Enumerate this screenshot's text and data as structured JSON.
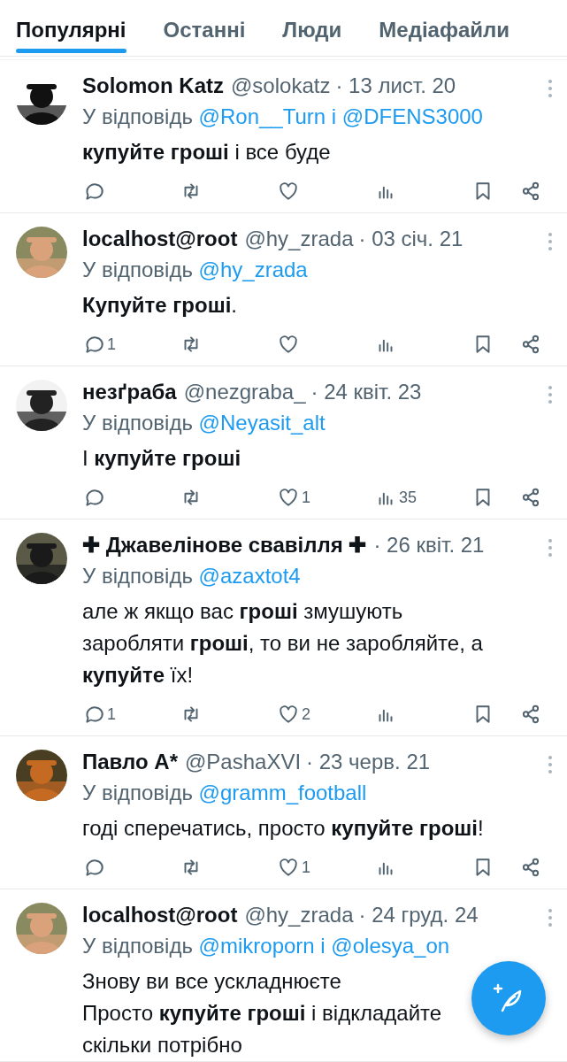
{
  "tabs": [
    {
      "label": "Популярні",
      "selected": true
    },
    {
      "label": "Останні",
      "selected": false
    },
    {
      "label": "Люди",
      "selected": false
    },
    {
      "label": "Медіафайли",
      "selected": false
    }
  ],
  "tweets": [
    {
      "name": "Solomon Katz",
      "handle": "@solokatz",
      "date": "· 13 лист. 20",
      "reply": {
        "label": "У відповідь",
        "mentions": [
          "@Ron__Turn",
          "@DFENS3000"
        ],
        "joiner": "і"
      },
      "text": "**купуйте гроші** і все буде",
      "actions": [
        {
          "kind": "reply"
        },
        {
          "kind": "retweet"
        },
        {
          "kind": "like"
        },
        {
          "kind": "views"
        }
      ]
    },
    {
      "name": "localhost@root",
      "handle": "@hy_zrada",
      "date": "· 03 січ. 21",
      "reply": {
        "label": "У відповідь",
        "mentions": [
          "@hy_zrada"
        ]
      },
      "text": "**Купуйте гроші**.",
      "actions": [
        {
          "kind": "reply",
          "count": "1"
        },
        {
          "kind": "retweet"
        },
        {
          "kind": "like"
        },
        {
          "kind": "views"
        }
      ]
    },
    {
      "name": "незґраба",
      "handle": "@nezgraba_",
      "date": "· 24 квіт. 23",
      "reply": {
        "label": "У відповідь",
        "mentions": [
          "@Neyasit_alt"
        ]
      },
      "text": "І **купуйте гроші**",
      "actions": [
        {
          "kind": "reply"
        },
        {
          "kind": "retweet"
        },
        {
          "kind": "like",
          "count": "1"
        },
        {
          "kind": "views",
          "count": "35"
        }
      ]
    },
    {
      "name": "✚ Джавелінове свавілля ✚",
      "date": "· 26 квіт. 21",
      "reply": {
        "label": "У відповідь",
        "mentions": [
          "@azaxtot4"
        ]
      },
      "text": "але ж якщо вас **гроші** змушують заробляти **гроші**, то ви не заробляйте, а **купуйте** їх!",
      "actions": [
        {
          "kind": "reply",
          "count": "1"
        },
        {
          "kind": "retweet"
        },
        {
          "kind": "like",
          "count": "2"
        },
        {
          "kind": "views"
        }
      ]
    },
    {
      "name": "Павло А*",
      "handle": "@PashaXVI",
      "date": "· 23 черв. 21",
      "reply": {
        "label": "У відповідь",
        "mentions": [
          "@gramm_football"
        ]
      },
      "text": "годі сперечатись, просто **купуйте гроші**!",
      "actions": [
        {
          "kind": "reply"
        },
        {
          "kind": "retweet"
        },
        {
          "kind": "like",
          "count": "1"
        },
        {
          "kind": "views"
        }
      ]
    },
    {
      "name": "localhost@root",
      "handle": "@hy_zrada",
      "date": "· 24 груд. 24",
      "reply": {
        "label": "У відповідь",
        "mentions": [
          "@mikroporn",
          "@olesya_on"
        ],
        "joiner": "і"
      },
      "text": "Знову ви все ускладнюєте\nПросто **купуйте гроші** і відкладайте\nскільки потрібно"
    }
  ]
}
